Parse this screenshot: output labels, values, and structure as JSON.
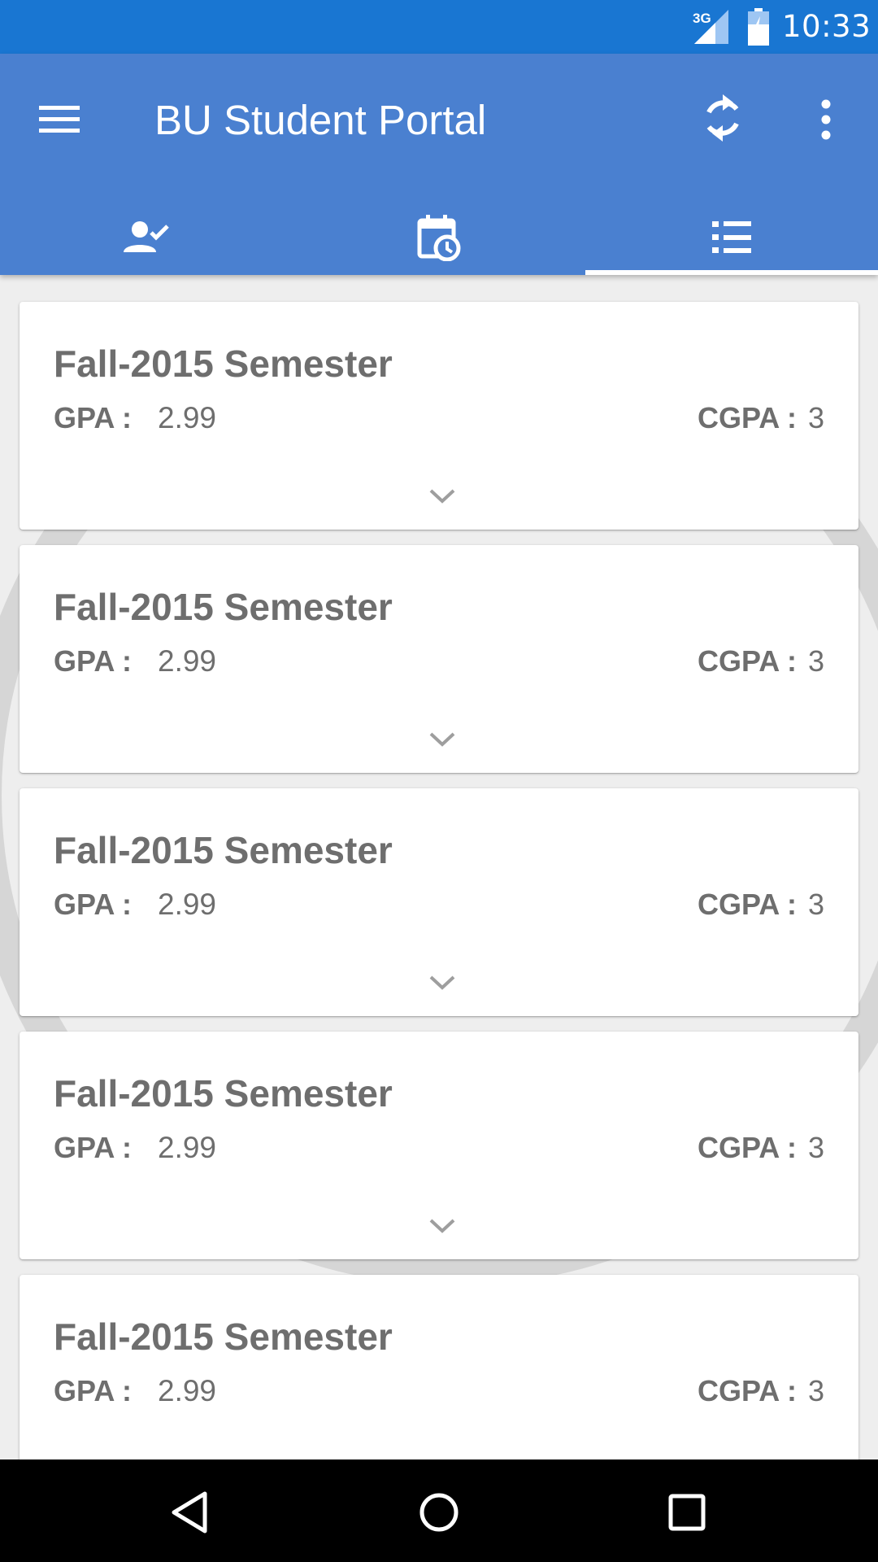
{
  "status_bar": {
    "network_label": "3G",
    "time": "10:33",
    "icons": [
      "signal-3g-icon",
      "battery-charging-icon"
    ]
  },
  "app_bar": {
    "title": "BU Student Portal",
    "icons": [
      "menu-icon",
      "sync-icon",
      "more-vert-icon"
    ]
  },
  "tabs": [
    {
      "icon": "person-check-icon",
      "selected": false
    },
    {
      "icon": "calendar-clock-icon",
      "selected": false
    },
    {
      "icon": "list-icon",
      "selected": true
    }
  ],
  "labels": {
    "gpa": "GPA :",
    "cgpa": "CGPA :"
  },
  "semesters": [
    {
      "title": "Fall-2015 Semester",
      "gpa": "2.99",
      "cgpa": "3"
    },
    {
      "title": "Fall-2015 Semester",
      "gpa": "2.99",
      "cgpa": "3"
    },
    {
      "title": "Fall-2015 Semester",
      "gpa": "2.99",
      "cgpa": "3"
    },
    {
      "title": "Fall-2015 Semester",
      "gpa": "2.99",
      "cgpa": "3"
    },
    {
      "title": "Fall-2015 Semester",
      "gpa": "2.99",
      "cgpa": "3"
    }
  ],
  "nav_bar": {
    "icons": [
      "back-icon",
      "home-icon",
      "recents-icon"
    ]
  },
  "colors": {
    "status_bar": "#1976d2",
    "app_bar": "#4a80d0",
    "background": "#eeeeee",
    "card_text": "#6e6e6e"
  }
}
